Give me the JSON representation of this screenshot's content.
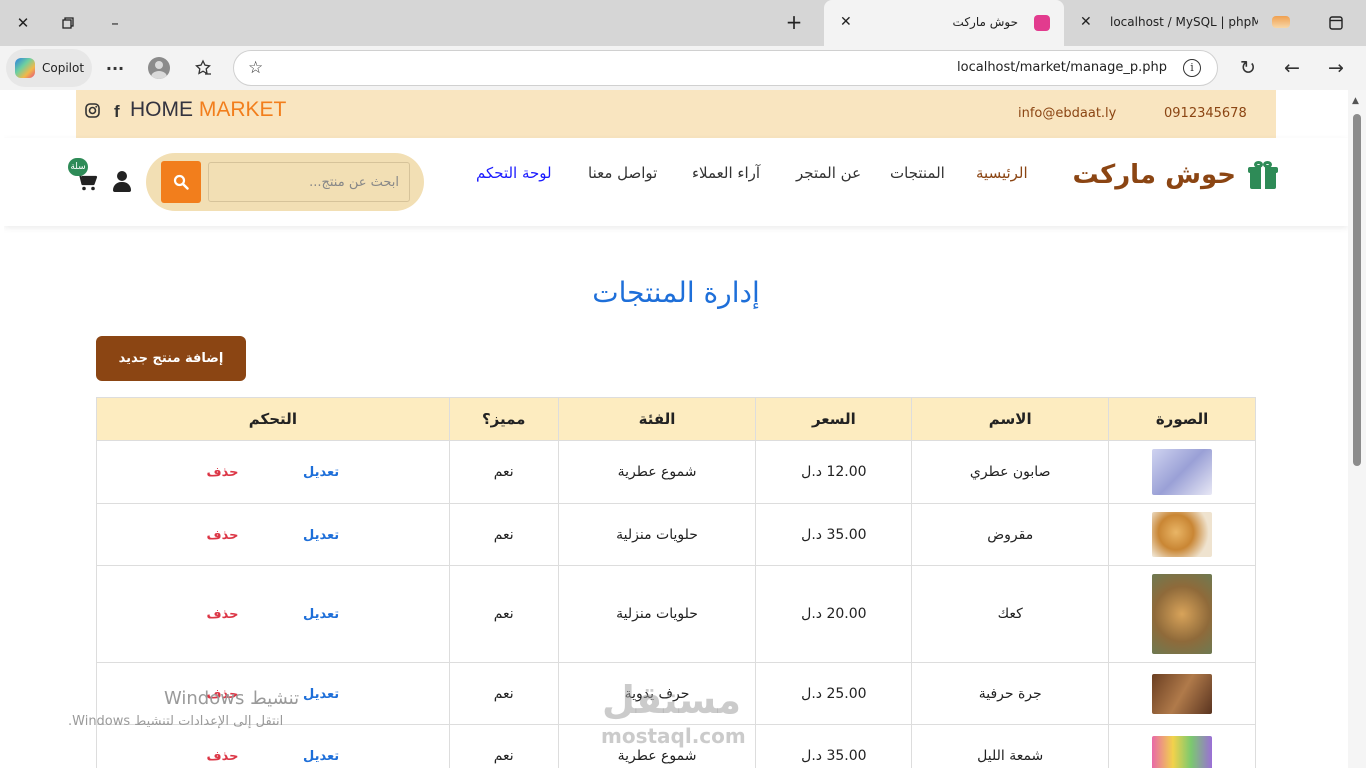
{
  "browser": {
    "tabs": [
      {
        "title": "localhost / MySQL | phpMy"
      },
      {
        "title": "حوش ماركت"
      }
    ],
    "copilot_label": "Copilot",
    "address": "localhost/market/manage_p.php"
  },
  "site": {
    "topbar": {
      "brand_part1": "HOME",
      "brand_part2": "MARKET",
      "email": "info@ebdaat.ly",
      "phone": "0912345678"
    },
    "logo": "حوش ماركت",
    "nav": [
      "الرئيسية",
      "المنتجات",
      "عن المتجر",
      "آراء العملاء",
      "تواصل معنا",
      "لوحة التحكم"
    ],
    "search_placeholder": "ابحث عن منتج...",
    "cart_badge": "سلة"
  },
  "main": {
    "title": "إدارة المنتجات",
    "add_button": "إضافة منتج جديد",
    "table": {
      "headers": [
        "الصورة",
        "الاسم",
        "السعر",
        "الفئة",
        "مميز؟",
        "التحكم"
      ],
      "rows": [
        {
          "name": "صابون عطري",
          "price": "12.00 د.ل",
          "category": "شموع عطرية",
          "featured": "نعم",
          "edit": "تعديل",
          "delete": "حذف"
        },
        {
          "name": "مقروض",
          "price": "35.00 د.ل",
          "category": "حلويات منزلية",
          "featured": "نعم",
          "edit": "تعديل",
          "delete": "حذف"
        },
        {
          "name": "كعك",
          "price": "20.00 د.ل",
          "category": "حلويات منزلية",
          "featured": "نعم",
          "edit": "تعديل",
          "delete": "حذف"
        },
        {
          "name": "جرة حرفية",
          "price": "25.00 د.ل",
          "category": "حرف يدوية",
          "featured": "نعم",
          "edit": "تعديل",
          "delete": "حذف"
        },
        {
          "name": "شمعة الليل",
          "price": "35.00 د.ل",
          "category": "شموع عطرية",
          "featured": "نعم",
          "edit": "تعديل",
          "delete": "حذف"
        }
      ]
    }
  },
  "overlay": {
    "windows_line1": "تنشيط Windows",
    "windows_line2": "انتقل إلى الإعدادات لتنشيط Windows.",
    "watermark_ar": "مستقل",
    "watermark_en": "mostaql.com"
  },
  "colors": {
    "accent_brown": "#8b4513",
    "accent_orange": "#f27e1c",
    "title_blue": "#1e6fd9",
    "delete_red": "#dc3545",
    "topbar_bg": "#f9e5c0"
  }
}
